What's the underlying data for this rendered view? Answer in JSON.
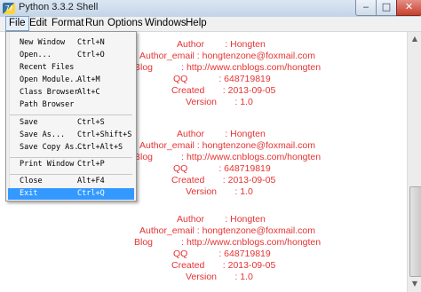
{
  "window": {
    "title": "Python 3.3.2 Shell",
    "app_icon": "python-icon",
    "controls": {
      "minimize": "‒",
      "maximize": "□",
      "close": "✕"
    }
  },
  "menubar": [
    "File",
    "Edit",
    "Format",
    "Run",
    "Options",
    "Windows",
    "Help"
  ],
  "file_menu": {
    "groups": [
      [
        {
          "label": "New Window",
          "accel": "Ctrl+N"
        },
        {
          "label": "Open...",
          "accel": "Ctrl+O"
        },
        {
          "label": "Recent Files",
          "accel": ""
        },
        {
          "label": "Open Module...",
          "accel": "Alt+M"
        },
        {
          "label": "Class Browser",
          "accel": "Alt+C"
        },
        {
          "label": "Path Browser",
          "accel": ""
        }
      ],
      [
        {
          "label": "Save",
          "accel": "Ctrl+S"
        },
        {
          "label": "Save As...",
          "accel": "Ctrl+Shift+S"
        },
        {
          "label": "Save Copy As...",
          "accel": "Ctrl+Alt+S"
        }
      ],
      [
        {
          "label": "Print Window",
          "accel": "Ctrl+P"
        }
      ],
      [
        {
          "label": "Close",
          "accel": "Alt+F4"
        },
        {
          "label": "Exit",
          "accel": "Ctrl+Q",
          "highlighted": true
        }
      ]
    ]
  },
  "shell_output": [
    [
      "Author        : Hongten",
      "Author_email : hongtenzone@foxmail.com",
      "Blog           : http://www.cnblogs.com/hongten",
      "QQ            : 648719819",
      "Created       : 2013-09-05",
      "Version       : 1.0"
    ],
    [
      "Author        : Hongten",
      "Author_email : hongtenzone@foxmail.com",
      "Blog           : http://www.cnblogs.com/hongten",
      "QQ            : 648719819",
      "Created       : 2013-09-05",
      "Version       : 1.0"
    ],
    [
      "Author        : Hongten",
      "Author_email : hongtenzone@foxmail.com",
      "Blog           : http://www.cnblogs.com/hongten",
      "QQ            : 648719819",
      "Created       : 2013-09-05",
      "Version       : 1.0"
    ]
  ],
  "colors": {
    "output_text": "#e53333",
    "menu_highlight": "#3399ff"
  }
}
